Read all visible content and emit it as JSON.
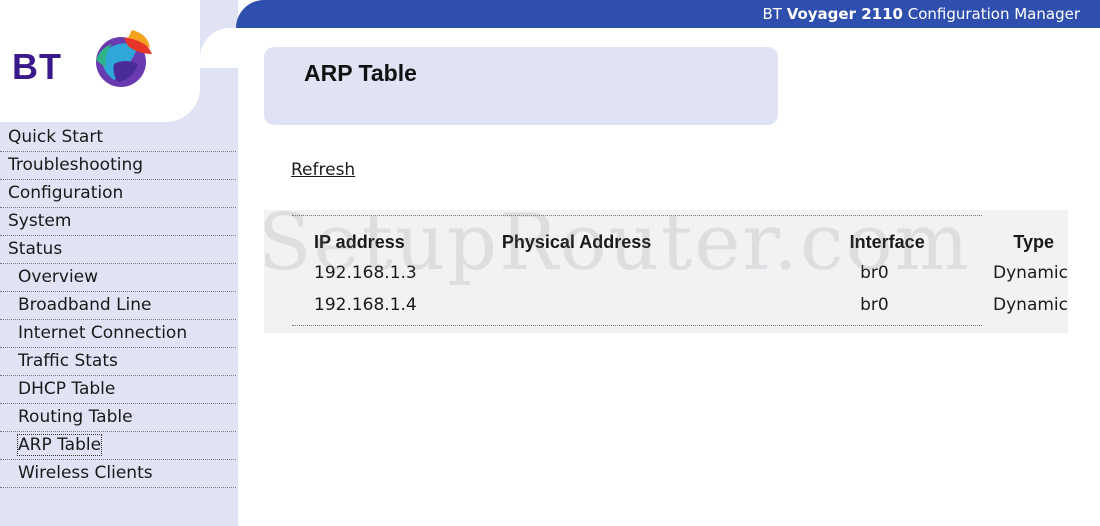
{
  "header": {
    "brand": "BT",
    "model": "Voyager 2110",
    "suffix": "Configuration Manager"
  },
  "logo": {
    "text": "BT"
  },
  "nav": {
    "items": [
      {
        "label": "Quick Start"
      },
      {
        "label": "Troubleshooting"
      },
      {
        "label": "Configuration"
      },
      {
        "label": "System"
      },
      {
        "label": "Status"
      }
    ],
    "status_items": [
      {
        "label": "Overview"
      },
      {
        "label": "Broadband Line"
      },
      {
        "label": "Internet Connection"
      },
      {
        "label": "Traffic Stats"
      },
      {
        "label": "DHCP Table"
      },
      {
        "label": "Routing Table"
      },
      {
        "label": "ARP Table"
      },
      {
        "label": "Wireless Clients"
      }
    ],
    "selected": "ARP Table"
  },
  "page": {
    "title": "ARP Table",
    "refresh_label": "Refresh"
  },
  "arp_table": {
    "columns": [
      "IP address",
      "Physical Address",
      "Interface",
      "Type"
    ],
    "rows": [
      {
        "ip": "192.168.1.3",
        "mac": "",
        "interface": "br0",
        "type": "Dynamic"
      },
      {
        "ip": "192.168.1.4",
        "mac": "",
        "interface": "br0",
        "type": "Dynamic"
      }
    ]
  },
  "watermark": "SetupRouter.com",
  "colors": {
    "header_bar": "#2f4fae",
    "panel": "#dfe3f4",
    "logo_text": "#3a1a8a"
  }
}
